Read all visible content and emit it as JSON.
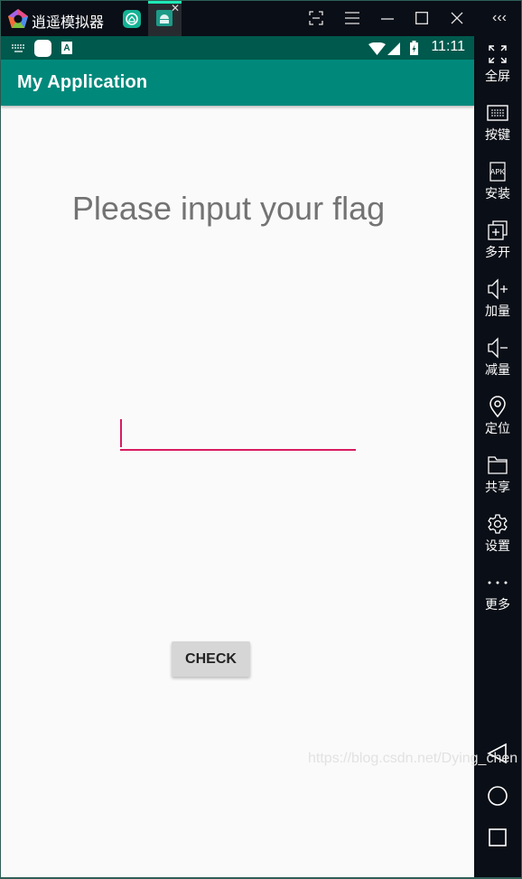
{
  "window": {
    "app_name": "逍遥模拟器",
    "logo_icon": "memu-logo-icon",
    "tabs": [
      {
        "name": "home-tab",
        "icon": "home-icon"
      },
      {
        "name": "my-application-tab",
        "icon": "android-icon",
        "active": true,
        "close": "✕"
      }
    ],
    "controls": [
      {
        "name": "screenshot-button",
        "icon": "screenshot-icon",
        "glyph": "⛶"
      },
      {
        "name": "menu-button",
        "icon": "hamburger-icon",
        "glyph": "☰"
      },
      {
        "name": "minimize-button",
        "icon": "minimize-icon",
        "glyph": "—"
      },
      {
        "name": "maximize-button",
        "icon": "maximize-icon",
        "glyph": "☐"
      },
      {
        "name": "close-button",
        "icon": "close-icon",
        "glyph": "✕"
      },
      {
        "name": "collapse-sidebar-button",
        "icon": "triple-chevron-left-icon",
        "glyph": "‹‹‹"
      }
    ],
    "accent": "#1de9b6"
  },
  "statusbar": {
    "time": "11:11",
    "left_icons": [
      "keyboard-icon",
      "notification-icon",
      "accessibility-icon"
    ],
    "right_icons": [
      "wifi-icon",
      "signal-icon",
      "battery-charging-icon"
    ]
  },
  "appbar": {
    "title": "My Application",
    "color": "#00897b"
  },
  "main": {
    "prompt": "Please input your flag",
    "input": {
      "value": "",
      "placeholder": "",
      "accent": "#d81b60"
    },
    "check_button": "CHECK"
  },
  "watermark": "https://blog.csdn.net/Dying_chen",
  "sidebar": {
    "items": [
      {
        "label": "全屏",
        "icon": "fullscreen-icon"
      },
      {
        "label": "按键",
        "icon": "keyboard-icon"
      },
      {
        "label": "安装",
        "icon": "apk-install-icon"
      },
      {
        "label": "多开",
        "icon": "multi-instance-icon"
      },
      {
        "label": "加量",
        "icon": "volume-up-icon"
      },
      {
        "label": "减量",
        "icon": "volume-down-icon"
      },
      {
        "label": "定位",
        "icon": "location-icon"
      },
      {
        "label": "共享",
        "icon": "folder-icon"
      },
      {
        "label": "设置",
        "icon": "gear-icon"
      },
      {
        "label": "更多",
        "icon": "more-icon"
      }
    ],
    "nav": [
      "back-icon",
      "home-circle-icon",
      "recents-icon"
    ]
  }
}
